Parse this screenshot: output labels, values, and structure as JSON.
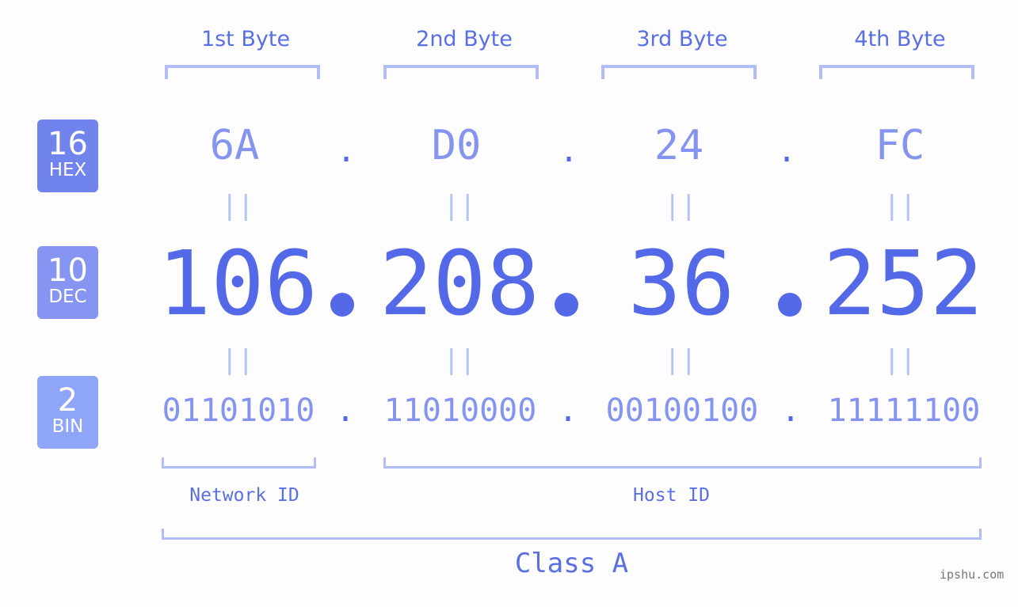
{
  "byte_headers": [
    "1st Byte",
    "2nd Byte",
    "3rd Byte",
    "4th Byte"
  ],
  "badges": {
    "hex": {
      "num": "16",
      "label": "HEX",
      "color": "#7183ec"
    },
    "dec": {
      "num": "10",
      "label": "DEC",
      "color": "#8595f1"
    },
    "bin": {
      "num": "2",
      "label": "BIN",
      "color": "#8fa6f8"
    }
  },
  "hex": [
    "6A",
    "D0",
    "24",
    "FC"
  ],
  "dec": [
    "106",
    "208",
    "36",
    "252"
  ],
  "bin": [
    "01101010",
    "11010000",
    "00100100",
    "11111100"
  ],
  "separator": ".",
  "equals": "||",
  "network_label": "Network ID",
  "host_label": "Host ID",
  "class_label": "Class A",
  "watermark": "ipshu.com"
}
